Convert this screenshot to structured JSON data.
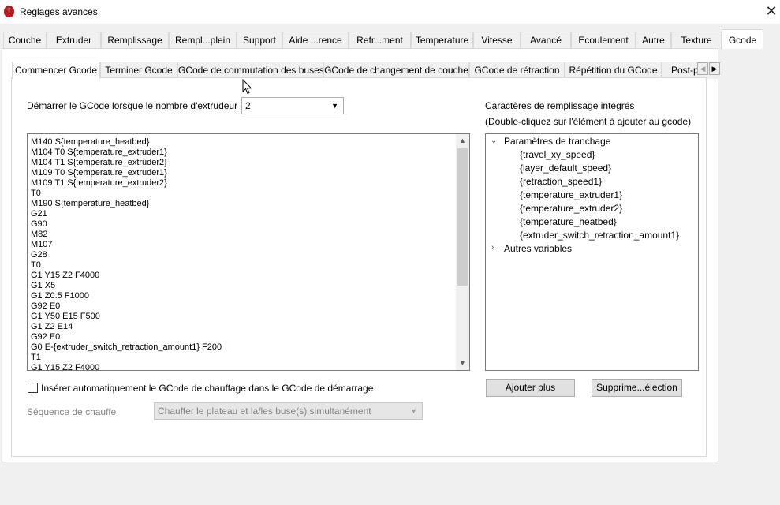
{
  "window": {
    "title": "Reglages avances",
    "close_glyph": "✕"
  },
  "top_tabs": [
    {
      "label": "Couche"
    },
    {
      "label": "Extruder"
    },
    {
      "label": "Remplissage"
    },
    {
      "label": "Rempl...plein"
    },
    {
      "label": "Support"
    },
    {
      "label": "Aide ...rence"
    },
    {
      "label": "Refr...ment"
    },
    {
      "label": "Temperature"
    },
    {
      "label": "Vitesse"
    },
    {
      "label": "Avancé"
    },
    {
      "label": "Ecoulement"
    },
    {
      "label": "Autre"
    },
    {
      "label": "Texture"
    },
    {
      "label": "Gcode"
    }
  ],
  "active_top_tab": "Gcode",
  "inner_tabs": [
    {
      "label": "Commencer Gcode"
    },
    {
      "label": "Terminer Gcode"
    },
    {
      "label": "GCode de commutation des buses"
    },
    {
      "label": "GCode de changement de couche"
    },
    {
      "label": "GCode de rétraction"
    },
    {
      "label": "Répétition du GCode"
    },
    {
      "label": "Post-p"
    }
  ],
  "active_inner_tab": "Commencer Gcode",
  "start_gcode": {
    "extruder_count_label": "Démarrer le GCode lorsque le nombre d'extrudeur est",
    "extruder_count_value": "2",
    "lines": [
      "M140 S{temperature_heatbed}",
      "M104 T0 S{temperature_extruder1}",
      "M104 T1 S{temperature_extruder2}",
      "M109 T0 S{temperature_extruder1}",
      "M109 T1 S{temperature_extruder2}",
      "T0",
      "M190 S{temperature_heatbed}",
      "G21",
      "G90",
      "M82",
      "M107",
      "G28",
      "T0",
      "G1 Y15 Z2 F4000",
      "G1 X5",
      "G1 Z0.5 F1000",
      "G92 E0",
      "G1 Y50 E15 F500",
      "G1 Z2 E14",
      "G92 E0",
      "G0 E-{extruder_switch_retraction_amount1} F200",
      "T1",
      "G1 Y15 Z2 F4000"
    ],
    "auto_insert_label": "Insérer automatiquement le GCode de chauffage dans le GCode de démarrage",
    "auto_insert_checked": false,
    "heat_sequence_label": "Séquence de chauffe",
    "heat_sequence_value": "Chauffer le plateau et la/les buse(s) simultanément"
  },
  "placeholders": {
    "header": "Caractères de remplissage intégrés",
    "hint": "(Double-cliquez sur l'élément à ajouter au gcode)",
    "tree": {
      "group_expanded": "Paramètres de tranchage",
      "items": [
        "{travel_xy_speed}",
        "{layer_default_speed}",
        "{retraction_speed1}",
        "{temperature_extruder1}",
        "{temperature_extruder2}",
        "{temperature_heatbed}",
        "{extruder_switch_retraction_amount1}"
      ],
      "group_collapsed": "Autres variables"
    },
    "add_button": "Ajouter plus",
    "delete_button": "Supprime...élection"
  },
  "icons": {
    "app": "app-logo-icon",
    "close": "close-icon",
    "scroll_left": "chevron-left-icon",
    "scroll_right": "chevron-right-icon",
    "dropdown": "chevron-down-icon",
    "tree_expanded": "chevron-down-icon",
    "tree_collapsed": "chevron-right-icon",
    "cursor": "mouse-pointer-icon"
  },
  "colors": {
    "window_bg": "#f0f0f0",
    "pane_bg": "#ffffff",
    "app_icon": "#c0161d",
    "disabled_text": "#838383"
  }
}
